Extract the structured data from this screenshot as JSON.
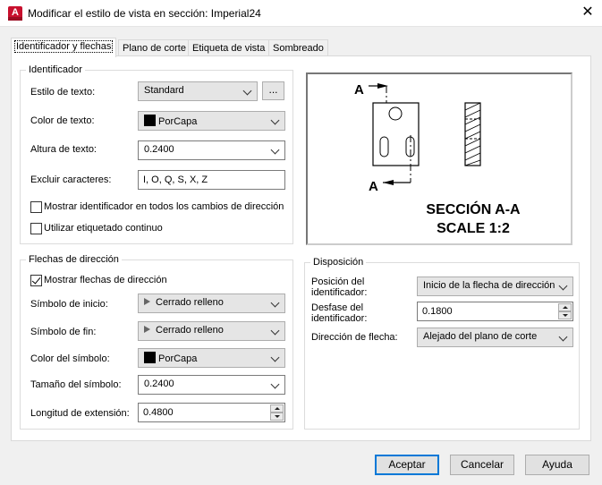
{
  "window": {
    "title": "Modificar el estilo de vista en sección: Imperial24",
    "app_icon": "A"
  },
  "tabs": [
    {
      "label": "Identificador y flechas",
      "active": true
    },
    {
      "label": "Plano de corte",
      "active": false
    },
    {
      "label": "Etiqueta de vista",
      "active": false
    },
    {
      "label": "Sombreado",
      "active": false
    }
  ],
  "identifier_group": {
    "legend": "Identificador",
    "text_style": {
      "label": "Estilo de texto:",
      "value": "Standard",
      "browse": "..."
    },
    "text_color": {
      "label": "Color de texto:",
      "value": "PorCapa",
      "swatch_color": "#000000"
    },
    "text_height": {
      "label": "Altura de texto:",
      "value": "0.2400"
    },
    "exclude_chars": {
      "label": "Excluir caracteres:",
      "value": "I, O, Q, S, X, Z"
    },
    "show_all_direction_changes": {
      "label": "Mostrar identificador en todos los cambios de dirección",
      "checked": false
    },
    "continuous_labeling": {
      "label": "Utilizar etiquetado continuo",
      "checked": false
    }
  },
  "arrows_group": {
    "legend": "Flechas de dirección",
    "show_arrows": {
      "label": "Mostrar flechas de dirección",
      "checked": true
    },
    "start_symbol": {
      "label": "Símbolo de inicio:",
      "value": "Cerrado relleno"
    },
    "end_symbol": {
      "label": "Símbolo de fin:",
      "value": "Cerrado relleno"
    },
    "symbol_color": {
      "label": "Color del símbolo:",
      "value": "PorCapa",
      "swatch_color": "#000000"
    },
    "symbol_size": {
      "label": "Tamaño del símbolo:",
      "value": "0.2400"
    },
    "extension_length": {
      "label": "Longitud de extensión:",
      "value": "0.4800"
    }
  },
  "layout_group": {
    "legend": "Disposición",
    "identifier_position": {
      "label_line1": "Posición del",
      "label_line2": "identificador:",
      "value": "Inicio de la flecha de dirección"
    },
    "identifier_offset": {
      "label_line1": "Desfase del",
      "label_line2": "identificador:",
      "value": "0.1800"
    },
    "arrow_direction": {
      "label": "Dirección de flecha:",
      "value": "Alejado del plano de corte"
    }
  },
  "preview": {
    "marker_top": "A",
    "marker_bottom": "A",
    "caption_line1": "SECCIÓN A-A",
    "caption_line2": "SCALE 1:2"
  },
  "buttons": {
    "ok": "Aceptar",
    "cancel": "Cancelar",
    "help": "Ayuda"
  }
}
